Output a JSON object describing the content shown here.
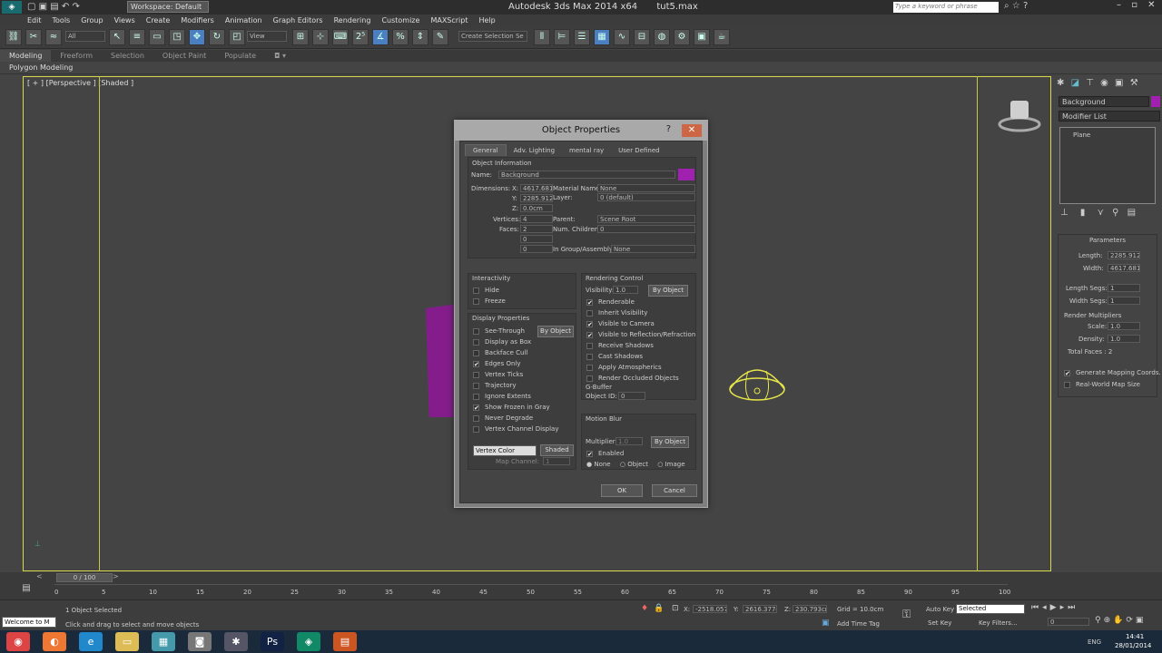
{
  "app": {
    "workspace": "Workspace: Default",
    "title": "Autodesk 3ds Max 2014 x64",
    "file": "tut5.max",
    "search_placeholder": "Type a keyword or phrase"
  },
  "menu": [
    "Edit",
    "Tools",
    "Group",
    "Views",
    "Create",
    "Modifiers",
    "Animation",
    "Graph Editors",
    "Rendering",
    "Customize",
    "MAXScript",
    "Help"
  ],
  "toolbar": {
    "filter": "All",
    "ref_coord": "View",
    "selection_set": "Create Selection Se"
  },
  "ribbon": {
    "tabs": [
      "Modeling",
      "Freeform",
      "Selection",
      "Object Paint",
      "Populate"
    ],
    "sub": "Polygon Modeling"
  },
  "viewport": {
    "label": "[ + ] [Perspective ] [Shaded ]"
  },
  "command_panel": {
    "object_name": "Background",
    "modifier_list": "Modifier List",
    "stack_item": "Plane",
    "params_title": "Parameters",
    "length_label": "Length:",
    "length": "2285.912",
    "width_label": "Width:",
    "width": "4617.681",
    "length_segs_label": "Length Segs:",
    "length_segs": "1",
    "width_segs_label": "Width Segs:",
    "width_segs": "1",
    "render_mult": "Render Multipliers",
    "scale_label": "Scale:",
    "scale": "1.0",
    "density_label": "Density:",
    "density": "1.0",
    "total_faces": "Total Faces : 2",
    "gen_mapping": "Generate Mapping Coords.",
    "real_world": "Real-World Map Size"
  },
  "dialog": {
    "title": "Object Properties",
    "help": "?",
    "close": "✕",
    "tabs": [
      "General",
      "Adv. Lighting",
      "mental ray",
      "User Defined"
    ],
    "obj_info": "Object Information",
    "name_label": "Name:",
    "name": "Background",
    "color": "#a020b0",
    "dimensions_label": "Dimensions:",
    "x_label": "X:",
    "x": "4617.681c",
    "y_label": "Y:",
    "y": "2285.912c",
    "z_label": "Z:",
    "z": "0.0cm",
    "material_label": "Material Name:",
    "material": "None",
    "layer_label": "Layer:",
    "layer": "0 (default)",
    "vertices_label": "Vertices:",
    "vertices": "4",
    "faces_label": "Faces:",
    "faces": "2",
    "parent_label": "Parent:",
    "parent": "Scene Root",
    "children_label": "Num. Children:",
    "children": "0",
    "extra1": "0",
    "extra2": "0",
    "group_label": "In Group/Assembly:",
    "group": "None",
    "interactivity": "Interactivity",
    "hide": "Hide",
    "freeze": "Freeze",
    "display_props": "Display Properties",
    "by_object": "By Object",
    "display_items": [
      {
        "label": "See-Through",
        "checked": false
      },
      {
        "label": "Display as Box",
        "checked": false
      },
      {
        "label": "Backface Cull",
        "checked": false
      },
      {
        "label": "Edges Only",
        "checked": true
      },
      {
        "label": "Vertex Ticks",
        "checked": false
      },
      {
        "label": "Trajectory",
        "checked": false
      },
      {
        "label": "Ignore Extents",
        "checked": false
      },
      {
        "label": "Show Frozen in Gray",
        "checked": true
      },
      {
        "label": "Never Degrade",
        "checked": false
      },
      {
        "label": "Vertex Channel Display",
        "checked": false
      }
    ],
    "vertex_color": "Vertex Color",
    "shaded": "Shaded",
    "map_channel_label": "Map Channel:",
    "map_channel": "1",
    "render_control": "Rendering Control",
    "visibility_label": "Visibility:",
    "visibility": "1.0",
    "render_items": [
      {
        "label": "Renderable",
        "checked": true
      },
      {
        "label": "Inherit Visibility",
        "checked": false
      },
      {
        "label": "Visible to Camera",
        "checked": true
      },
      {
        "label": "Visible to Reflection/Refraction",
        "checked": true
      },
      {
        "label": "Receive Shadows",
        "checked": false
      },
      {
        "label": "Cast Shadows",
        "checked": false
      },
      {
        "label": "Apply Atmospherics",
        "checked": false
      },
      {
        "label": "Render Occluded Objects",
        "checked": false
      }
    ],
    "gbuffer": "G-Buffer",
    "object_id_label": "Object ID:",
    "object_id": "0",
    "motion_blur": "Motion Blur",
    "multiplier_label": "Multiplier:",
    "multiplier": "1.0",
    "enabled": "Enabled",
    "mb_none": "None",
    "mb_object": "Object",
    "mb_image": "Image",
    "ok": "OK",
    "cancel": "Cancel"
  },
  "timeline": {
    "frame": "0 / 100",
    "ticks": [
      "0",
      "5",
      "10",
      "15",
      "20",
      "25",
      "30",
      "35",
      "40",
      "45",
      "50",
      "55",
      "60",
      "65",
      "70",
      "75",
      "80",
      "85",
      "90",
      "95",
      "100"
    ]
  },
  "status": {
    "welcome": "Welcome to M",
    "selected": "1 Object Selected",
    "hint": "Click and drag to select and move objects",
    "x_label": "X:",
    "x": "-2518.057c",
    "y_label": "Y:",
    "y": "2616.377c",
    "z_label": "Z:",
    "z": "230.793cm",
    "grid": "Grid = 10.0cm",
    "add_time_tag": "Add Time Tag",
    "auto_key": "Auto Key",
    "selected_set": "Selected",
    "set_key": "Set Key",
    "key_filters": "Key Filters...",
    "frame": "0"
  },
  "taskbar": {
    "lang": "ENG",
    "time": "14:41",
    "date": "28/01/2014"
  }
}
